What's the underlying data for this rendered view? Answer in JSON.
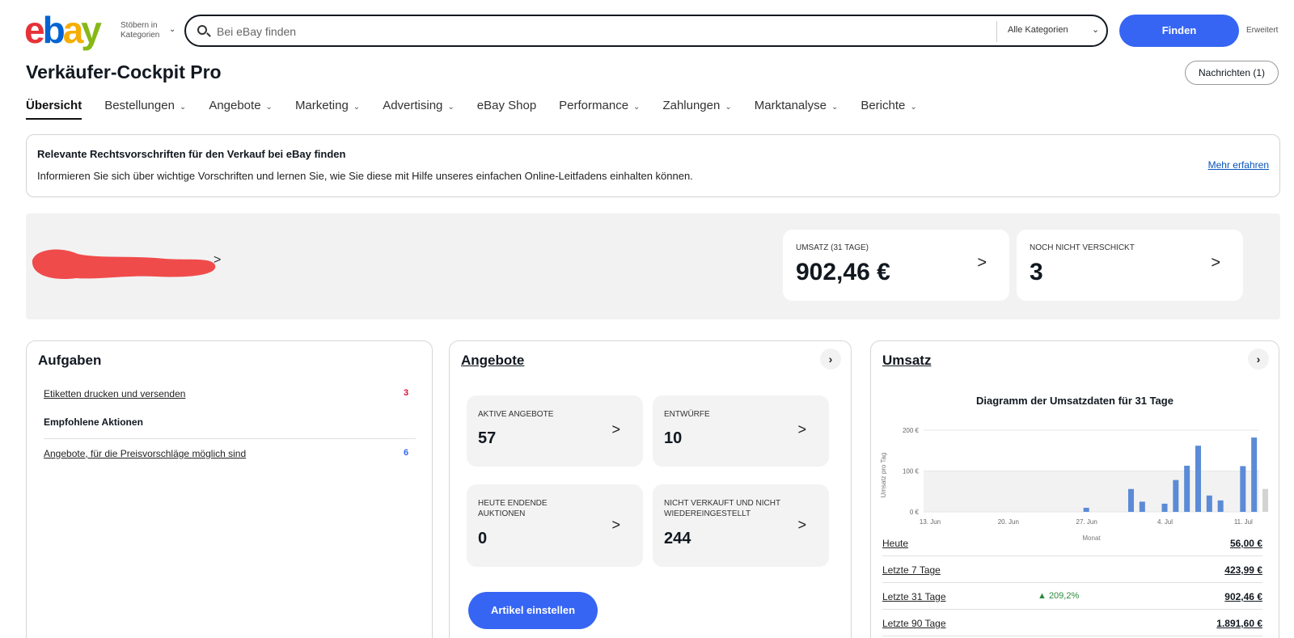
{
  "header": {
    "logo": [
      "e",
      "b",
      "a",
      "y"
    ],
    "browse_line1": "Stöbern in",
    "browse_line2": "Kategorien",
    "search_placeholder": "Bei eBay finden",
    "category_select": "Alle Kategorien",
    "find_label": "Finden",
    "advanced_label": "Erweitert"
  },
  "page": {
    "title": "Verkäufer-Cockpit Pro",
    "messages_label": "Nachrichten (1)"
  },
  "nav": [
    {
      "label": "Übersicht",
      "dropdown": false,
      "active": true
    },
    {
      "label": "Bestellungen",
      "dropdown": true
    },
    {
      "label": "Angebote",
      "dropdown": true
    },
    {
      "label": "Marketing",
      "dropdown": true
    },
    {
      "label": "Advertising",
      "dropdown": true
    },
    {
      "label": "eBay Shop",
      "dropdown": false
    },
    {
      "label": "Performance",
      "dropdown": true
    },
    {
      "label": "Zahlungen",
      "dropdown": true
    },
    {
      "label": "Marktanalyse",
      "dropdown": true
    },
    {
      "label": "Berichte",
      "dropdown": true
    }
  ],
  "notice": {
    "title": "Relevante Rechtsvorschriften für den Verkauf bei eBay finden",
    "text": "Informieren Sie sich über wichtige Vorschriften und lernen Sie, wie Sie diese mit Hilfe unseres einfachen Online-Leitfadens einhalten können.",
    "link": "Mehr erfahren"
  },
  "summary": {
    "revenue_label": "UMSATZ (31 TAGE)",
    "revenue_value": "902,46 €",
    "unshipped_label": "NOCH NICHT VERSCHICKT",
    "unshipped_value": "3",
    "redaction_color": "#f04b4b"
  },
  "tasks": {
    "title": "Aufgaben",
    "items": [
      {
        "label": "Etiketten drucken und versenden",
        "count": "3",
        "count_color": "#e0103a"
      }
    ],
    "recommended_title": "Empfohlene Aktionen",
    "recommended": [
      {
        "label": "Angebote, für die Preisvorschläge möglich sind",
        "count": "6",
        "count_color": "#3665f3"
      }
    ]
  },
  "listings": {
    "title": "Angebote",
    "tiles": [
      {
        "label": "AKTIVE ANGEBOTE",
        "value": "57"
      },
      {
        "label": "ENTWÜRFE",
        "value": "10"
      },
      {
        "label": "HEUTE ENDENDE AUKTIONEN",
        "value": "0"
      },
      {
        "label": "NICHT VERKAUFT UND NICHT WIEDEREINGESTELLT",
        "value": "244"
      }
    ],
    "button": "Artikel einstellen"
  },
  "revenue": {
    "title": "Umsatz",
    "chart_title": "Diagramm der Umsatzdaten für 31 Tage",
    "rows": [
      {
        "label": "Heute",
        "value": "56,00 €",
        "delta": ""
      },
      {
        "label": "Letzte 7 Tage",
        "value": "423,99 €",
        "delta": ""
      },
      {
        "label": "Letzte 31 Tage",
        "value": "902,46 €",
        "delta": "▲ 209,2%"
      },
      {
        "label": "Letzte 90 Tage",
        "value": "1.891,60 €",
        "delta": ""
      }
    ]
  },
  "chart_data": {
    "type": "bar",
    "title": "Diagramm der Umsatzdaten für 31 Tage",
    "xlabel": "Monat",
    "ylabel": "Umsatz pro Tag",
    "y_ticks": [
      "0 €",
      "100 €",
      "200 €"
    ],
    "ylim": [
      0,
      200
    ],
    "x_ticks": [
      "13. Jun",
      "20. Jun",
      "27. Jun",
      "4. Jul",
      "11. Jul"
    ],
    "x_tick_days": [
      0,
      7,
      14,
      21,
      28
    ],
    "average_band": 100,
    "bar_color": "#5b8bd6",
    "today_color": "#d3d3d3",
    "days": [
      14,
      18,
      19,
      21,
      22,
      23,
      24,
      25,
      26,
      28,
      29,
      30,
      31
    ],
    "values": [
      10,
      56,
      25,
      20,
      78,
      113,
      162,
      40,
      28,
      112,
      182,
      56,
      0
    ],
    "today_index": 11
  }
}
